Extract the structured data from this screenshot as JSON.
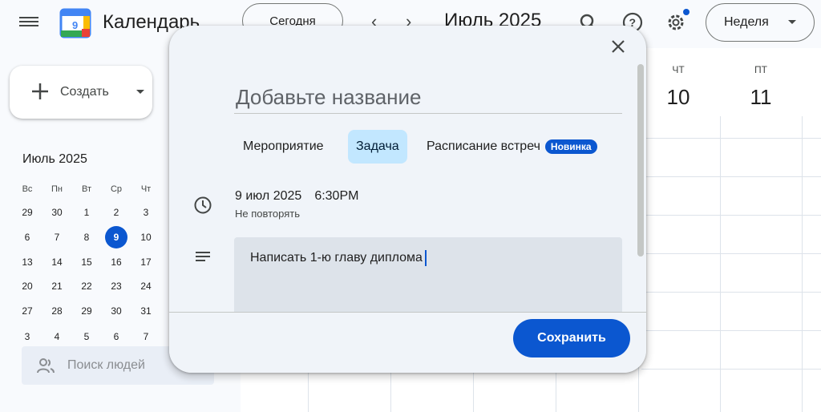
{
  "header": {
    "app_title": "Календарь",
    "today_label": "Сегодня",
    "prev_arrow": "‹",
    "next_arrow": "›",
    "month_label": "Июль 2025",
    "view_label": "Неделя"
  },
  "sidebar": {
    "create_label": "Создать",
    "mini_calendar": {
      "title": "Июль 2025",
      "weekdays": [
        "Вс",
        "Пн",
        "Вт",
        "Ср",
        "Чт"
      ],
      "weeks": [
        [
          "29",
          "30",
          "1",
          "2",
          "3"
        ],
        [
          "6",
          "7",
          "8",
          "9",
          "10"
        ],
        [
          "13",
          "14",
          "15",
          "16",
          "17"
        ],
        [
          "20",
          "21",
          "22",
          "23",
          "24"
        ],
        [
          "27",
          "28",
          "29",
          "30",
          "31"
        ],
        [
          "3",
          "4",
          "5",
          "6",
          "7"
        ]
      ],
      "selected": "9"
    },
    "people_search_placeholder": "Поиск людей"
  },
  "week_view": {
    "days": [
      {
        "name": "ЧТ",
        "number": "10"
      },
      {
        "name": "ПТ",
        "number": "11"
      }
    ]
  },
  "dialog": {
    "title_placeholder": "Добавьте название",
    "tabs": [
      {
        "label": "Мероприятие",
        "active": false
      },
      {
        "label": "Задача",
        "active": true
      },
      {
        "label": "Расписание встреч",
        "active": false
      }
    ],
    "new_badge": "Новинка",
    "date": "9 июл 2025",
    "time": "6:30PM",
    "repeat": "Не повторять",
    "description": "Написать 1-ю главу диплома",
    "save_label": "Сохранить"
  },
  "colors": {
    "accent": "#0b57d0",
    "active_tab": "#c2e7ff",
    "dialog_bg": "#f0f4f9",
    "page_bg": "#f8fafd"
  }
}
